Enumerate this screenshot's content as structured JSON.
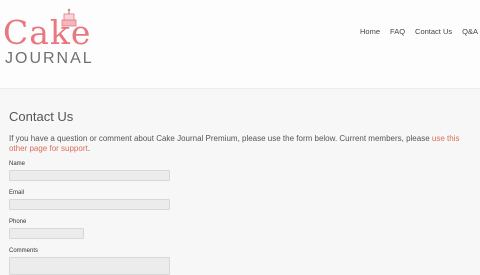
{
  "header": {
    "logo": {
      "cake_text": "Cake",
      "journal_text": "JOURNAL"
    },
    "nav": [
      "Home",
      "FAQ",
      "Contact Us",
      "Q&A"
    ]
  },
  "page": {
    "title": "Contact Us",
    "intro_text": "If you have a question or comment about Cake Journal Premium, please use the form below. Current members, please",
    "intro_link": "use this other page for support",
    "intro_end": "."
  },
  "form": {
    "name_label": "Name",
    "email_label": "Email",
    "phone_label": "Phone",
    "comments_label": "Comments"
  },
  "colors": {
    "brand_pink": "#e8787f",
    "link": "#d96f58"
  }
}
